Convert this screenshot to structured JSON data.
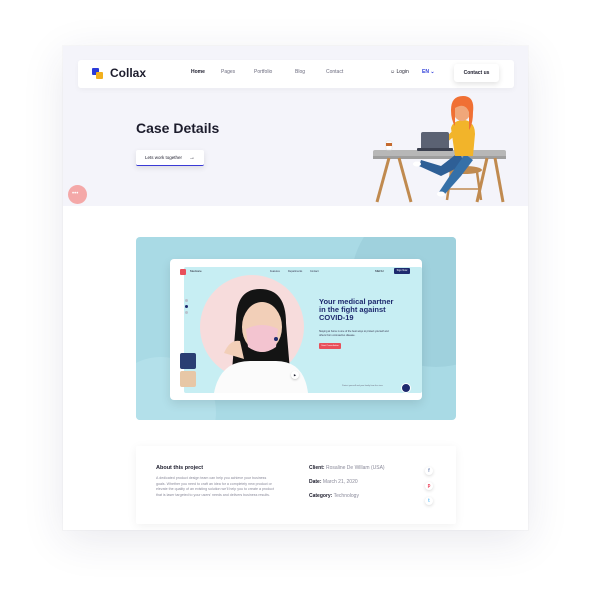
{
  "brand": {
    "name": "Collax"
  },
  "nav": {
    "items": [
      {
        "label": "Home",
        "active": true
      },
      {
        "label": "Pages",
        "active": false
      },
      {
        "label": "Portfolio",
        "active": false
      },
      {
        "label": "Blog",
        "active": false
      },
      {
        "label": "Contact",
        "active": false
      }
    ],
    "login": "Login",
    "language": "EN",
    "contact_button": "Contact us"
  },
  "hero": {
    "title": "Case Details",
    "button": "Lets work together",
    "chat_icon": "chat-bubble-icon"
  },
  "showcase": {
    "mock": {
      "logo": "Medcare",
      "nav": [
        "Features",
        "Departments",
        "Contact"
      ],
      "menu": "MENU",
      "button": "Sign Now",
      "heading": "Your medical partner in the fight against COVID-19",
      "subtext": "Staying at home is one of the best ways to protect yourself and others from coronavirus disease.",
      "cta": "Start Consultation",
      "footnote": "Protect yourself and your family from the virus."
    }
  },
  "about": {
    "title": "About this project",
    "text": "A dedicated product design team can help you achieve your business goals. Whether you need to craft an idea for a completely new product or elevate the quality of an existing solution we'll help you to create a product that is laser targeted to your users' needs and delivers business results.",
    "client_label": "Client:",
    "client_value": "Rosaline De Willam (USA)",
    "date_label": "Date:",
    "date_value": "March 21, 2020",
    "category_label": "Category:",
    "category_value": "Technology"
  },
  "social": [
    "facebook-icon",
    "pinterest-icon",
    "twitter-icon"
  ],
  "colors": {
    "accent": "#2b3bd9",
    "brand_yellow": "#f2b01e",
    "hero_bg": "#f4f4fa",
    "showcase_bg": "#a9dae5",
    "mock_navy": "#1e2a6e",
    "mock_red": "#e8505b"
  }
}
